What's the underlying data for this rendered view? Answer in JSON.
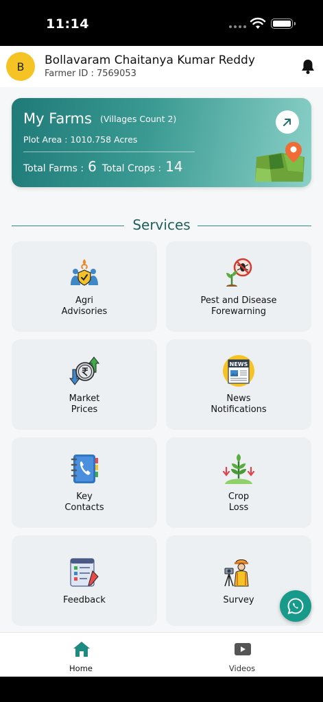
{
  "status_bar": {
    "time": "11:14"
  },
  "header": {
    "avatar_initial": "B",
    "user_name": "Bollavaram Chaitanya Kumar Reddy",
    "farmer_id": "Farmer ID : 7569053",
    "bell_icon": "bell-icon"
  },
  "farm_card": {
    "title": "My Farms",
    "villages": "(Villages Count 2)",
    "plot_area": "Plot Area : 1010.758 Acres",
    "total_farms_label": "Total Farms :",
    "total_farms_value": "6",
    "total_crops_label": "Total Crops :",
    "total_crops_value": "14",
    "arrow_icon": "arrow-up-right-icon",
    "colors": {
      "gradient_start": "#1f7a78",
      "gradient_end": "#8ad0c7"
    }
  },
  "services": {
    "title": "Services",
    "tiles": [
      {
        "line1": "Agri",
        "line2": "Advisories",
        "icon": "agri-advisory-icon"
      },
      {
        "line1": "Pest and Disease",
        "line2": "Forewarning",
        "icon": "pest-warning-icon"
      },
      {
        "line1": "Market",
        "line2": "Prices",
        "icon": "market-prices-icon"
      },
      {
        "line1": "News",
        "line2": "Notifications",
        "icon": "newspaper-icon"
      },
      {
        "line1": "Key",
        "line2": "Contacts",
        "icon": "contacts-book-icon"
      },
      {
        "line1": "Crop",
        "line2": "Loss",
        "icon": "crop-loss-icon"
      },
      {
        "line1": "Feedback",
        "line2": "",
        "icon": "feedback-form-icon"
      },
      {
        "line1": "Survey",
        "line2": "",
        "icon": "surveyor-icon"
      }
    ]
  },
  "bottom_nav": {
    "items": [
      {
        "label": "Home",
        "icon": "home-icon",
        "active": true
      },
      {
        "label": "Videos",
        "icon": "video-play-icon",
        "active": false
      }
    ]
  },
  "fab": {
    "icon": "whatsapp-icon",
    "color": "#179a8a"
  },
  "theme": {
    "accent": "#1f8a7f",
    "tile_bg": "#edf0f2",
    "avatar_bg": "#f6c325"
  }
}
